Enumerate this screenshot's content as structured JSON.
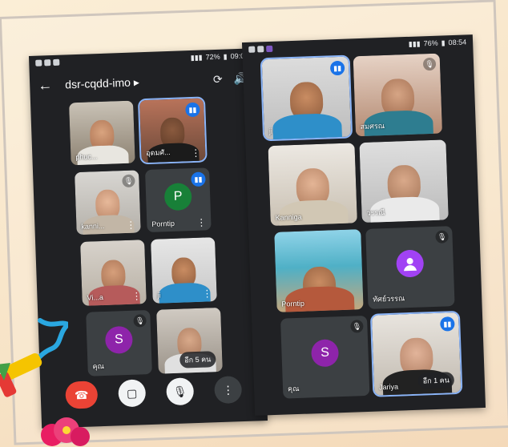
{
  "left_phone": {
    "status": {
      "battery": "72%",
      "time": "09:04"
    },
    "meeting_code": "dsr-cqdd-imo",
    "title_chevron": "▸",
    "tiles": [
      {
        "name": "phuc...",
        "speaking": false,
        "muted": false
      },
      {
        "name": "อุดมศั...",
        "speaking": true,
        "muted": false
      },
      {
        "name": "kanni...",
        "speaking": false,
        "muted": true
      },
      {
        "name": "Porntip",
        "avatar_letter": "P",
        "avatar_color": "#188038",
        "speaking": true,
        "muted": false
      },
      {
        "name": "Vi...a",
        "speaking": false,
        "muted": false
      },
      {
        "name": "ji",
        "speaking": false,
        "muted": false
      },
      {
        "name": "คุณ",
        "avatar_letter": "S",
        "avatar_color": "#8e24aa",
        "speaking": false,
        "muted": true
      },
      {
        "name": "",
        "others": "อีก 5 คน",
        "speaking": false,
        "muted": false
      }
    ],
    "controls": [
      "end-call",
      "camera-off",
      "mic-off",
      "more"
    ]
  },
  "right_phone": {
    "status": {
      "battery": "76%",
      "time": "08:54"
    },
    "tiles": [
      {
        "name": "ji",
        "speaking": true,
        "muted": false
      },
      {
        "name": "สมศรณ",
        "speaking": false,
        "muted": true
      },
      {
        "name": "Kanniga",
        "speaking": false,
        "muted": false
      },
      {
        "name": "วรรณี",
        "speaking": false,
        "muted": false
      },
      {
        "name": "Porntip",
        "speaking": false,
        "muted": false
      },
      {
        "name": "ทัศย์วรรณ",
        "avatar_letter": "",
        "avatar_color": "#a142f4",
        "speaking": false,
        "muted": true
      },
      {
        "name": "คุณ",
        "avatar_letter": "S",
        "avatar_color": "#8e24aa",
        "speaking": false,
        "muted": true
      },
      {
        "name": "Jariya",
        "others": "อีก 1 คน",
        "speaking": true,
        "muted": false
      }
    ]
  },
  "colors": {
    "phone_bg": "#202124",
    "tile_bg": "#3c4043",
    "accent": "#1a73e8",
    "end_call": "#ea4335"
  }
}
